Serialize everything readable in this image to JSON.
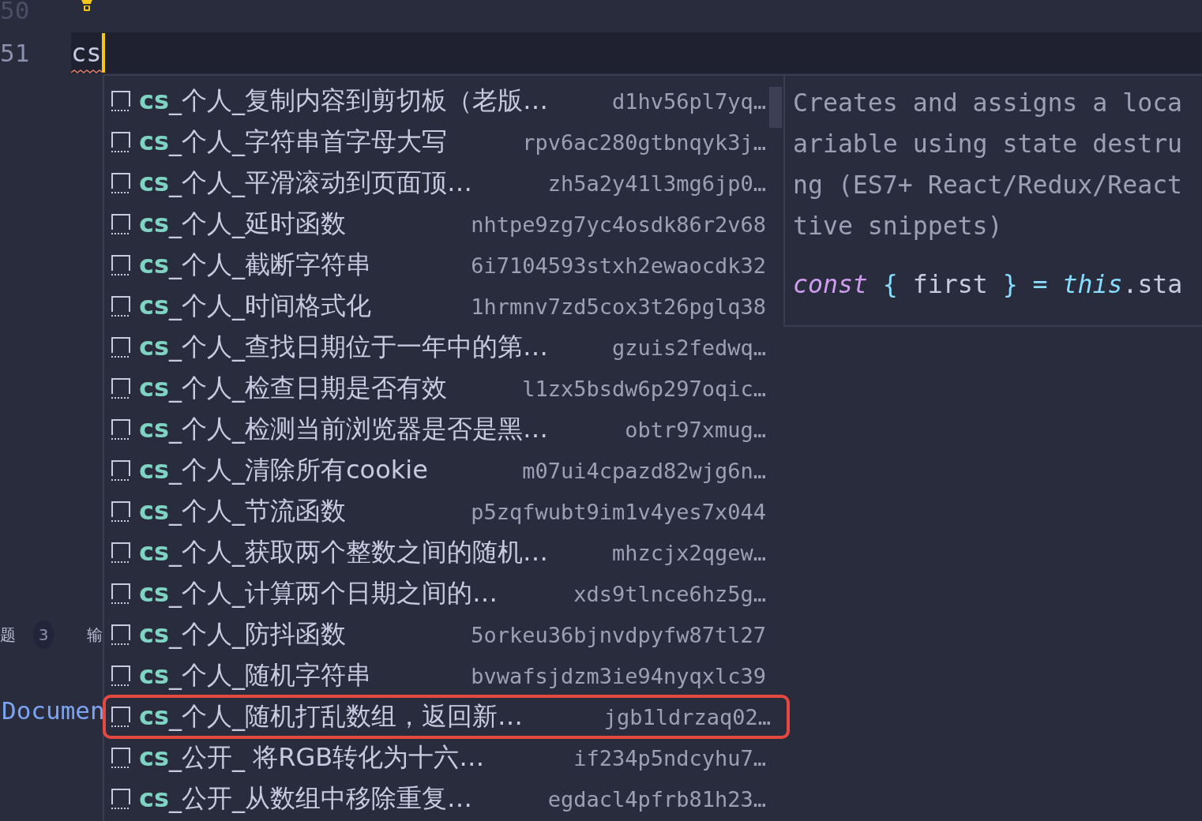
{
  "editor": {
    "lines": [
      {
        "number": "50",
        "kind": "hint"
      },
      {
        "number": "51",
        "kind": "current",
        "text": "cs",
        "squiggle": true
      }
    ]
  },
  "side_panel": {
    "tab_1": "题",
    "badge": "3",
    "tab_2": "输",
    "outline_item": "Documen"
  },
  "suggestions": [
    {
      "match": "cs",
      "rest": "_个人_复制内容到剪切板（老版…",
      "detail": "d1hv56pl7yq…",
      "outlined": false
    },
    {
      "match": "cs",
      "rest": "_个人_字符串首字母大写",
      "detail": "rpv6ac280gtbnqyk3j…",
      "outlined": false
    },
    {
      "match": "cs",
      "rest": "_个人_平滑滚动到页面顶…",
      "detail": "zh5a2y41l3mg6jp0…",
      "outlined": false
    },
    {
      "match": "cs",
      "rest": "_个人_延时函数",
      "detail": "nhtpe9zg7yc4osdk86r2v68",
      "outlined": false
    },
    {
      "match": "cs",
      "rest": "_个人_截断字符串",
      "detail": "6i7104593stxh2ewaocdk32",
      "outlined": false
    },
    {
      "match": "cs",
      "rest": "_个人_时间格式化",
      "detail": "1hrmnv7zd5cox3t26pglq38",
      "outlined": false
    },
    {
      "match": "cs",
      "rest": "_个人_查找日期位于一年中的第…",
      "detail": "gzuis2fedwq…",
      "outlined": false
    },
    {
      "match": "cs",
      "rest": "_个人_检查日期是否有效",
      "detail": "l1zx5bsdw6p297oqic…",
      "outlined": false
    },
    {
      "match": "cs",
      "rest": "_个人_检测当前浏览器是否是黑…",
      "detail": "obtr97xmug…",
      "outlined": false
    },
    {
      "match": "cs",
      "rest": "_个人_清除所有cookie",
      "detail": "m07ui4cpazd82wjg6n…",
      "outlined": false
    },
    {
      "match": "cs",
      "rest": "_个人_节流函数",
      "detail": "p5zqfwubt9im1v4yes7x044",
      "outlined": false
    },
    {
      "match": "cs",
      "rest": "_个人_获取两个整数之间的随机…",
      "detail": "mhzcjx2qgew…",
      "outlined": false
    },
    {
      "match": "cs",
      "rest": "_个人_计算两个日期之间的…",
      "detail": "xds9tlnce6hz5g…",
      "outlined": false
    },
    {
      "match": "cs",
      "rest": "_个人_防抖函数",
      "detail": "5orkeu36bjnvdpyfw87tl27",
      "outlined": false
    },
    {
      "match": "cs",
      "rest": "_个人_随机字符串",
      "detail": "bvwafsjdzm3ie94nyqxlc39",
      "outlined": false
    },
    {
      "match": "cs",
      "rest": "_个人_随机打乱数组，返回新…",
      "detail": "jgb1ldrzaq02…",
      "outlined": true
    },
    {
      "match": "cs",
      "rest": "_公开_ 将RGB转化为十六…",
      "detail": "if234p5ndcyhu7…",
      "outlined": false
    },
    {
      "match": "cs",
      "rest": "_公开_从数组中移除重复…",
      "detail": "egdacl4pfrb81h23…",
      "outlined": false
    }
  ],
  "details": {
    "description_lines": [
      "Creates and assigns a loca",
      "ariable using state destru",
      "ng (ES7+ React/Redux/React",
      "tive snippets)"
    ],
    "code": [
      {
        "kind": "keyword",
        "text": "const"
      },
      {
        "kind": "brace",
        "text": "{"
      },
      {
        "kind": "plain",
        "text": "first"
      },
      {
        "kind": "brace",
        "text": "}"
      },
      {
        "kind": "operator",
        "text": "="
      },
      {
        "kind": "this",
        "text": "this"
      },
      {
        "kind": "plain",
        "text": ".sta"
      }
    ]
  }
}
